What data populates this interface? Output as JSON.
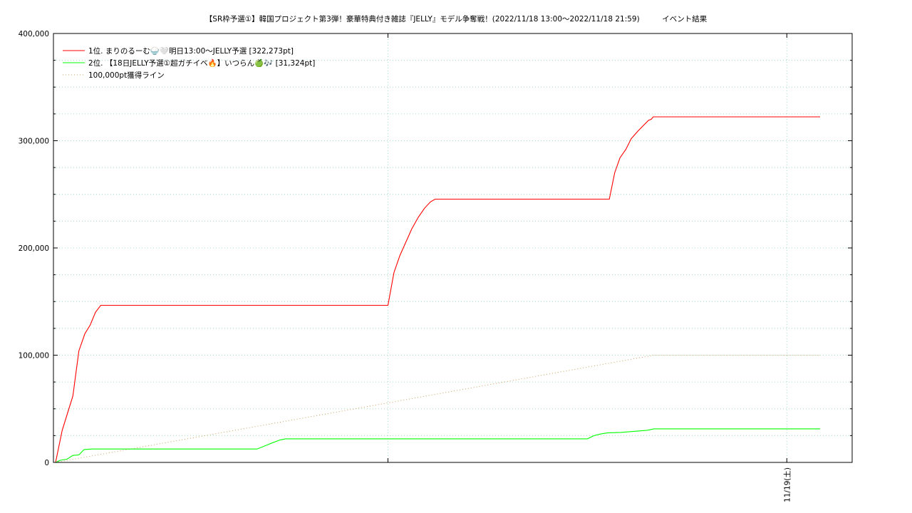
{
  "title": "【SR枠予選①】韓国プロジェクト第3弾！豪華特典付き雑誌『JELLY』モデル争奪戦！(2022/11/18 13:00～2022/11/18 21:59)　　　イベント結果",
  "colors": {
    "series1": "#ff0000",
    "series2": "#00ff00",
    "target_line": "#c8a060",
    "grid": "#a0e0c0",
    "axis": "#000000"
  },
  "chart_data": {
    "type": "line",
    "x_unit": "hours since event start",
    "xlim": [
      0,
      9
    ],
    "ylim": [
      0,
      400000
    ],
    "y_ticks": [
      {
        "value": 0,
        "label": "0"
      },
      {
        "value": 100000,
        "label": "100,000"
      },
      {
        "value": 200000,
        "label": "200,000"
      },
      {
        "value": 300000,
        "label": "300,000"
      },
      {
        "value": 400000,
        "label": "400,000"
      }
    ],
    "x_tick_labels": [
      {
        "x": 11,
        "label": "11/19(土)"
      }
    ],
    "grid": true,
    "legend_position": "top-left",
    "series": [
      {
        "name": "1位. まりのるーむ🍚🤍明日13:00〜JELLY予選 [322,273pt]",
        "color": "#ff0000",
        "style": "solid",
        "points": [
          [
            0.0,
            0
          ],
          [
            0.1,
            30000
          ],
          [
            0.26,
            62000
          ],
          [
            0.35,
            104000
          ],
          [
            0.44,
            120000
          ],
          [
            0.52,
            128000
          ],
          [
            0.6,
            140000
          ],
          [
            0.68,
            146500
          ],
          [
            5.0,
            146500
          ],
          [
            5.09,
            177000
          ],
          [
            5.18,
            193000
          ],
          [
            5.36,
            218000
          ],
          [
            5.46,
            229000
          ],
          [
            5.55,
            237000
          ],
          [
            5.64,
            243000
          ],
          [
            5.71,
            245500
          ],
          [
            8.33,
            245500
          ],
          [
            8.41,
            270000
          ],
          [
            8.49,
            284000
          ],
          [
            8.58,
            292000
          ],
          [
            8.66,
            302000
          ],
          [
            8.76,
            309000
          ],
          [
            8.84,
            314000
          ],
          [
            8.92,
            319000
          ],
          [
            8.96,
            320000
          ],
          [
            8.99,
            322273
          ],
          [
            11.5,
            322273
          ]
        ]
      },
      {
        "name": "2位. 【18日JELLY予選①超ガチイベ🔥】いつらん🍏🎶 [31,324pt]",
        "color": "#00ff00",
        "style": "solid",
        "points": [
          [
            0.0,
            0
          ],
          [
            0.07,
            2000
          ],
          [
            0.17,
            3000
          ],
          [
            0.26,
            6500
          ],
          [
            0.35,
            7000
          ],
          [
            0.43,
            12000
          ],
          [
            0.55,
            12500
          ],
          [
            3.03,
            12500
          ],
          [
            3.15,
            15500
          ],
          [
            3.27,
            18500
          ],
          [
            3.38,
            21000
          ],
          [
            3.46,
            22000
          ],
          [
            8.0,
            22000
          ],
          [
            8.1,
            25000
          ],
          [
            8.2,
            26500
          ],
          [
            8.3,
            27500
          ],
          [
            8.5,
            28000
          ],
          [
            8.7,
            29000
          ],
          [
            8.9,
            30000
          ],
          [
            9.0,
            31324
          ],
          [
            11.5,
            31324
          ]
        ]
      },
      {
        "name": "100,000pt獲得ライン",
        "color": "#c8a060",
        "style": "dotted",
        "points": [
          [
            0,
            0
          ],
          [
            9,
            100000
          ],
          [
            11.5,
            100000
          ]
        ]
      }
    ]
  }
}
